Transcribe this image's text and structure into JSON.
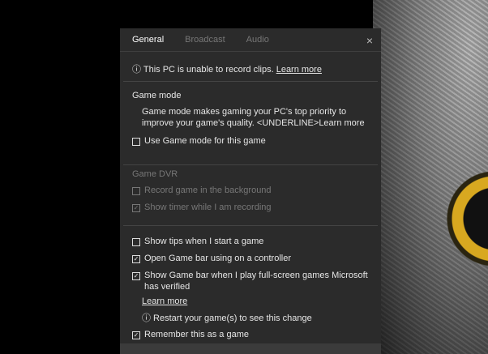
{
  "tabs": [
    "General",
    "Broadcast",
    "Audio"
  ],
  "notice": {
    "text": "ⓘ This PC is unable to record clips. ",
    "link": "Learn more"
  },
  "game_mode": {
    "title": "Game mode",
    "description": "Game mode makes gaming your PC's top priority to improve your game's quality. <UNDERLINE>Learn more",
    "checkbox": "Use Game mode for this game"
  },
  "game_dvr": {
    "title": "Game DVR",
    "record": "Record game in the background",
    "timer": "Show timer while I am recording"
  },
  "options": {
    "tips": "Show tips when I start a game",
    "open_bar": "Open Game bar using  on a controller",
    "show_bar": "Show Game bar when I play full-screen games Microsoft has verified",
    "learn_more": "Learn more",
    "restart": "ⓘ Restart your game(s) to see this change",
    "remember": "Remember this as a game"
  },
  "icons": {
    "close": "×",
    "check": "✓"
  }
}
